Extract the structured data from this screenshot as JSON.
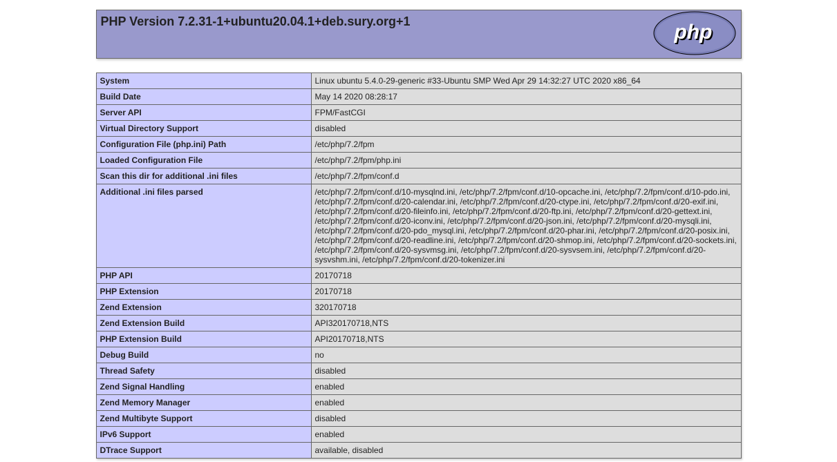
{
  "title": "PHP Version 7.2.31-1+ubuntu20.04.1+deb.sury.org+1",
  "rows": [
    {
      "label": "System",
      "value": "Linux ubuntu 5.4.0-29-generic #33-Ubuntu SMP Wed Apr 29 14:32:27 UTC 2020 x86_64"
    },
    {
      "label": "Build Date",
      "value": "May 14 2020 08:28:17"
    },
    {
      "label": "Server API",
      "value": "FPM/FastCGI"
    },
    {
      "label": "Virtual Directory Support",
      "value": "disabled"
    },
    {
      "label": "Configuration File (php.ini) Path",
      "value": "/etc/php/7.2/fpm"
    },
    {
      "label": "Loaded Configuration File",
      "value": "/etc/php/7.2/fpm/php.ini"
    },
    {
      "label": "Scan this dir for additional .ini files",
      "value": "/etc/php/7.2/fpm/conf.d"
    },
    {
      "label": "Additional .ini files parsed",
      "value": "/etc/php/7.2/fpm/conf.d/10-mysqlnd.ini, /etc/php/7.2/fpm/conf.d/10-opcache.ini, /etc/php/7.2/fpm/conf.d/10-pdo.ini, /etc/php/7.2/fpm/conf.d/20-calendar.ini, /etc/php/7.2/fpm/conf.d/20-ctype.ini, /etc/php/7.2/fpm/conf.d/20-exif.ini, /etc/php/7.2/fpm/conf.d/20-fileinfo.ini, /etc/php/7.2/fpm/conf.d/20-ftp.ini, /etc/php/7.2/fpm/conf.d/20-gettext.ini, /etc/php/7.2/fpm/conf.d/20-iconv.ini, /etc/php/7.2/fpm/conf.d/20-json.ini, /etc/php/7.2/fpm/conf.d/20-mysqli.ini, /etc/php/7.2/fpm/conf.d/20-pdo_mysql.ini, /etc/php/7.2/fpm/conf.d/20-phar.ini, /etc/php/7.2/fpm/conf.d/20-posix.ini, /etc/php/7.2/fpm/conf.d/20-readline.ini, /etc/php/7.2/fpm/conf.d/20-shmop.ini, /etc/php/7.2/fpm/conf.d/20-sockets.ini, /etc/php/7.2/fpm/conf.d/20-sysvmsg.ini, /etc/php/7.2/fpm/conf.d/20-sysvsem.ini, /etc/php/7.2/fpm/conf.d/20-sysvshm.ini, /etc/php/7.2/fpm/conf.d/20-tokenizer.ini"
    },
    {
      "label": "PHP API",
      "value": "20170718"
    },
    {
      "label": "PHP Extension",
      "value": "20170718"
    },
    {
      "label": "Zend Extension",
      "value": "320170718"
    },
    {
      "label": "Zend Extension Build",
      "value": "API320170718,NTS"
    },
    {
      "label": "PHP Extension Build",
      "value": "API20170718,NTS"
    },
    {
      "label": "Debug Build",
      "value": "no"
    },
    {
      "label": "Thread Safety",
      "value": "disabled"
    },
    {
      "label": "Zend Signal Handling",
      "value": "enabled"
    },
    {
      "label": "Zend Memory Manager",
      "value": "enabled"
    },
    {
      "label": "Zend Multibyte Support",
      "value": "disabled"
    },
    {
      "label": "IPv6 Support",
      "value": "enabled"
    },
    {
      "label": "DTrace Support",
      "value": "available, disabled"
    }
  ]
}
